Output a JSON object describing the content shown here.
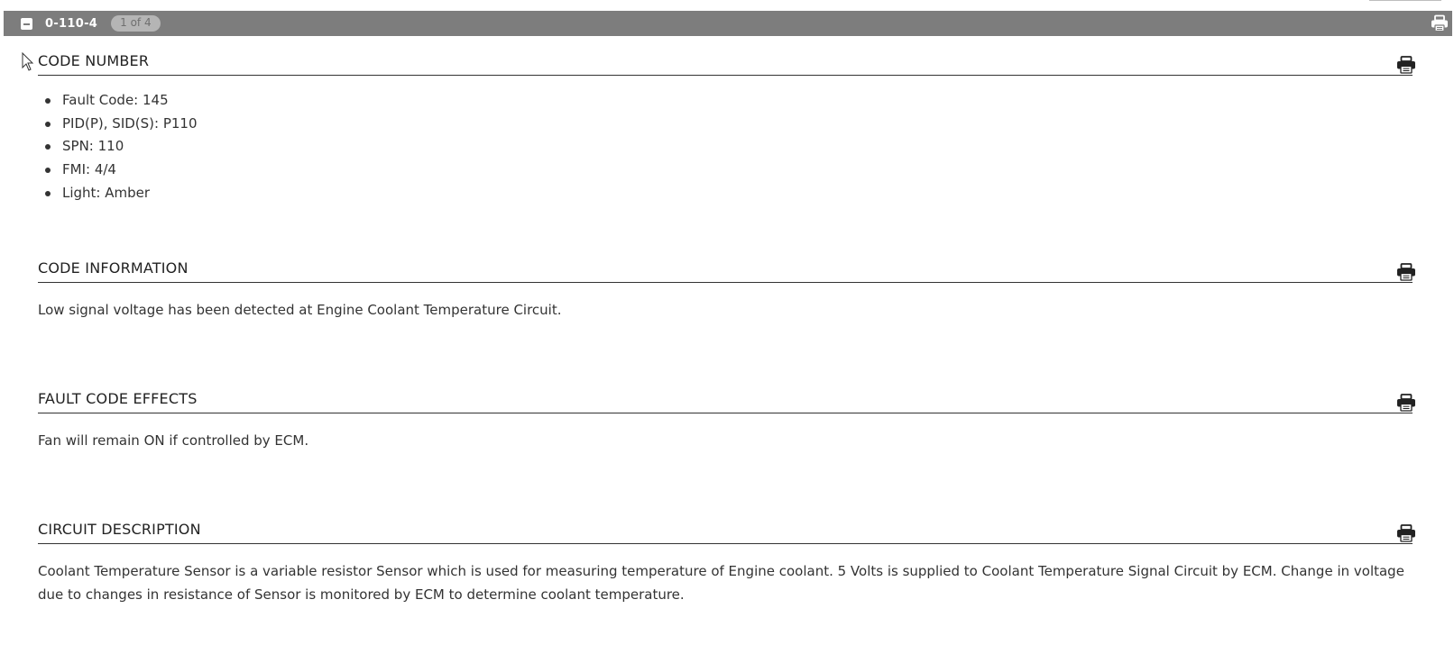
{
  "header": {
    "code": "0-110-4",
    "pager": "1 of 4"
  },
  "sections": {
    "code_number": {
      "title": "CODE NUMBER",
      "items": [
        "Fault Code: 145",
        "PID(P), SID(S): P110",
        "SPN: 110",
        "FMI: 4/4",
        "Light: Amber"
      ]
    },
    "code_information": {
      "title": "CODE INFORMATION",
      "text": "Low signal voltage has been detected at Engine Coolant Temperature Circuit."
    },
    "fault_code_effects": {
      "title": "FAULT CODE EFFECTS",
      "text": "Fan will remain ON if controlled by ECM."
    },
    "circuit_description": {
      "title": "CIRCUIT DESCRIPTION",
      "text": "Coolant Temperature Sensor is a variable resistor Sensor which is used for measuring temperature of Engine coolant. 5 Volts is supplied to Coolant Temperature Signal Circuit by ECM. Change in voltage due to changes in resistance of Sensor is monitored by ECM to determine coolant temperature."
    }
  },
  "icons": {
    "collapse": "minus-square-icon",
    "print": "printer-icon",
    "cursor": "mouse-pointer-icon"
  },
  "colors": {
    "header_bar": "#7d7d7d",
    "badge_bg": "#b5b5b5",
    "text": "#333333"
  }
}
